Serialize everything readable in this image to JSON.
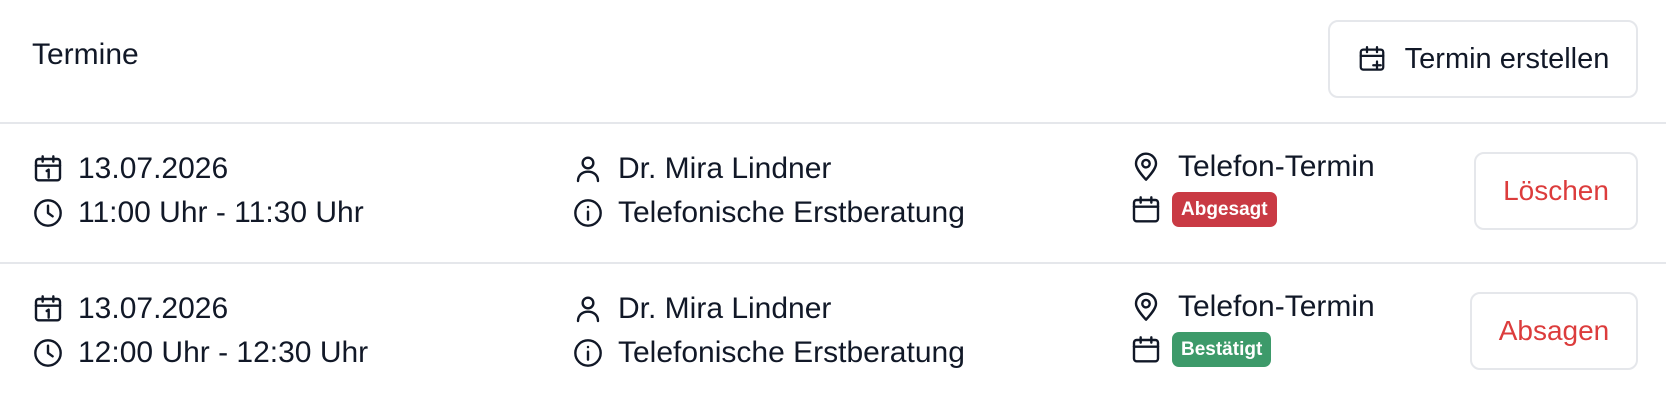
{
  "header": {
    "title": "Termine",
    "create_button_label": "Termin erstellen"
  },
  "appointments": [
    {
      "date": "13.07.2026",
      "time": "11:00 Uhr - 11:30 Uhr",
      "person": "Dr. Mira Lindner",
      "type": "Telefonische Erstberatung",
      "location": "Telefon-Termin",
      "status": "Abgesagt",
      "status_color": "#c93a44",
      "action": "Löschen"
    },
    {
      "date": "13.07.2026",
      "time": "12:00 Uhr - 12:30 Uhr",
      "person": "Dr. Mira Lindner",
      "type": "Telefonische Erstberatung",
      "location": "Telefon-Termin",
      "status": "Bestätigt",
      "status_color": "#3d9a6a",
      "action": "Absagen"
    }
  ],
  "colors": {
    "danger_text": "#dc3c3c",
    "divider": "#e5e7eb",
    "text": "#111827"
  }
}
